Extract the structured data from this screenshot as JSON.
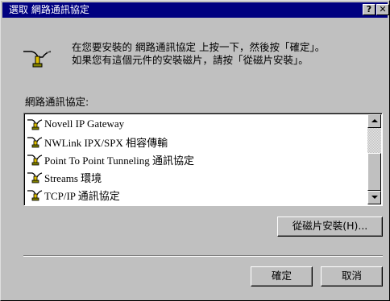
{
  "window": {
    "title": "選取 網路通訊協定",
    "help_label": "?",
    "close_label": "✕"
  },
  "header": {
    "icon": "network-protocol-icon",
    "line1": "在您要安裝的 網路通訊協定 上按一下，然後按「確定」。",
    "line2": "如果您有這個元件的安裝磁片，請按「從磁片安裝」。"
  },
  "protocol_list": {
    "label": "網路通訊協定:",
    "items": [
      {
        "label": "Novell IP Gateway",
        "icon": "protocol-icon"
      },
      {
        "label": "NWLink IPX/SPX 相容傳輸",
        "icon": "protocol-icon"
      },
      {
        "label": "Point To Point Tunneling 通訊協定",
        "icon": "protocol-icon"
      },
      {
        "label": "Streams 環境",
        "icon": "protocol-icon"
      },
      {
        "label": "TCP/IP 通訊協定",
        "icon": "protocol-icon"
      }
    ]
  },
  "buttons": {
    "have_disk": "從磁片安裝(H)...",
    "ok": "確定",
    "cancel": "取消"
  },
  "colors": {
    "titlebar": "#000080",
    "face": "#c0c0c0"
  }
}
